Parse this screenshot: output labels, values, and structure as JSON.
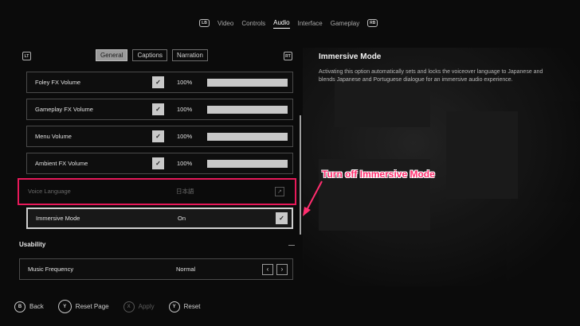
{
  "topnav": {
    "left_badge": "LB",
    "right_badge": "RB",
    "tabs": [
      {
        "label": "Video",
        "active": false
      },
      {
        "label": "Controls",
        "active": false
      },
      {
        "label": "Audio",
        "active": true
      },
      {
        "label": "Interface",
        "active": false
      },
      {
        "label": "Gameplay",
        "active": false
      }
    ]
  },
  "subtabs": {
    "left_badge": "LT",
    "right_badge": "RT",
    "items": [
      {
        "label": "General",
        "active": true
      },
      {
        "label": "Captions",
        "active": false
      },
      {
        "label": "Narration",
        "active": false
      }
    ]
  },
  "settings": {
    "volumes": [
      {
        "label": "Foley FX Volume",
        "percent_text": "100%",
        "level": 1.0,
        "checked": true
      },
      {
        "label": "Gameplay FX Volume",
        "percent_text": "100%",
        "level": 1.0,
        "checked": true
      },
      {
        "label": "Menu Volume",
        "percent_text": "100%",
        "level": 1.0,
        "checked": true
      },
      {
        "label": "Ambient FX Volume",
        "percent_text": "100%",
        "level": 1.0,
        "checked": true
      }
    ],
    "voice_language": {
      "label": "Voice Language",
      "value": "日本語",
      "icon": "external-link-icon",
      "disabled": true
    },
    "immersive_mode": {
      "label": "Immersive Mode",
      "value": "On",
      "checked": true
    },
    "usability_section": "Usability",
    "music_frequency": {
      "label": "Music Frequency",
      "value": "Normal",
      "prev": "‹",
      "next": "›"
    }
  },
  "info_panel": {
    "title": "Immersive Mode",
    "description": "Activating this option automatically sets and locks the voiceover language to Japanese and blends Japanese and Portuguese dialogue for an immersive audio experience."
  },
  "annotation": {
    "text": "Turn off Immersive Mode",
    "color": "#ff2d6e"
  },
  "footer": [
    {
      "button": "B",
      "label": "Back",
      "enabled": true
    },
    {
      "button": "Y",
      "label": "Reset Page",
      "enabled": true
    },
    {
      "button": "X",
      "label": "Apply",
      "enabled": false
    },
    {
      "button": "Y",
      "label": "Reset",
      "enabled": true
    }
  ],
  "colors": {
    "background": "#0b0b0b",
    "accent_highlight": "#e8195a",
    "active_tab": "#ffffff"
  }
}
